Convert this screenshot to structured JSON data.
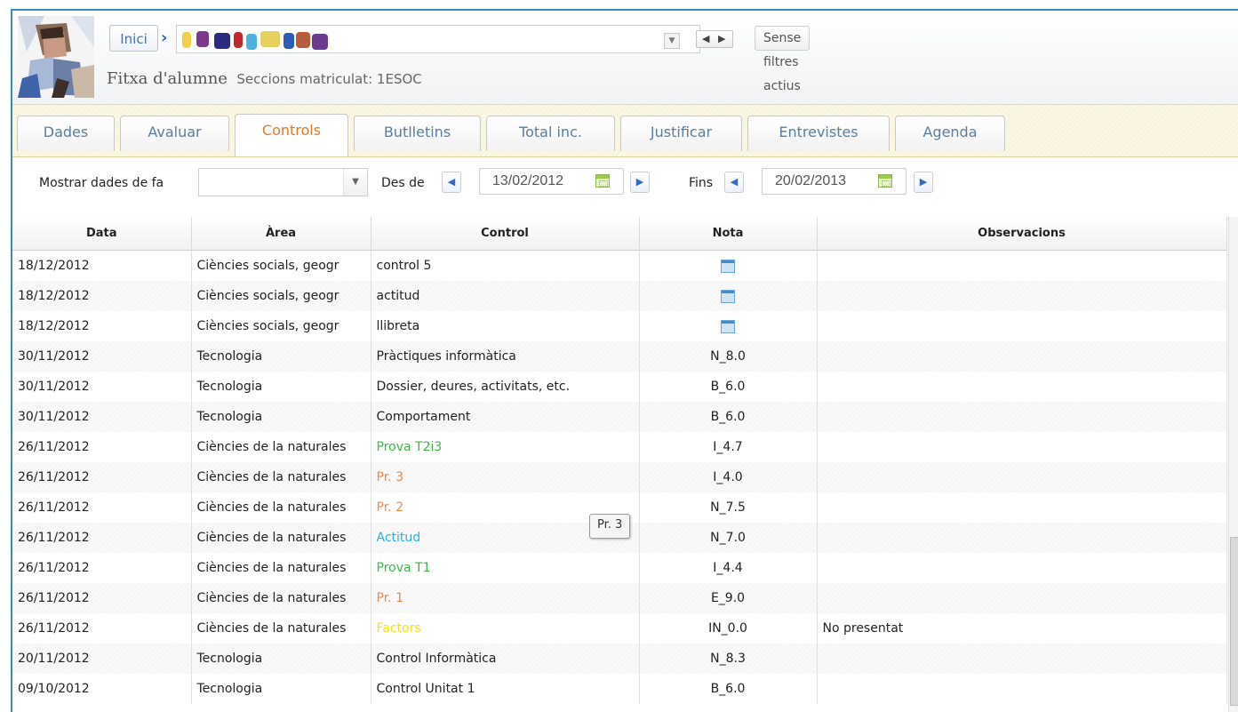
{
  "nav": {
    "home_label": "Inici",
    "crumb_sep": "›",
    "prev_glyph": "◀",
    "next_glyph": "▶",
    "filters_label": "Sense filtres actius"
  },
  "student": {
    "title": "Fitxa d'alumne",
    "sections": "Seccions matriculat: 1ESOC"
  },
  "tabs": [
    {
      "label": "Dades"
    },
    {
      "label": "Avaluar"
    },
    {
      "label": "Controls",
      "active": true
    },
    {
      "label": "Butlletins"
    },
    {
      "label": "Total inc."
    },
    {
      "label": "Justificar"
    },
    {
      "label": "Entrevistes"
    },
    {
      "label": "Agenda"
    }
  ],
  "filters": {
    "show_label": "Mostrar dades de fa",
    "show_value": "",
    "from_label": "Des de",
    "from_date": "13/02/2012",
    "to_label": "Fins",
    "to_date": "20/02/2013"
  },
  "table": {
    "columns": [
      "Data",
      "Àrea",
      "Control",
      "Nota",
      "Observacions"
    ],
    "rows": [
      {
        "date": "18/12/2012",
        "area": "Ciències socials, geogr",
        "control": "control 5",
        "nota": "",
        "obs": "",
        "color": "#222222"
      },
      {
        "date": "18/12/2012",
        "area": "Ciències socials, geogr",
        "control": "actitud",
        "nota": "",
        "obs": "",
        "color": "#222222"
      },
      {
        "date": "18/12/2012",
        "area": "Ciències socials, geogr",
        "control": "llibreta",
        "nota": "",
        "obs": "",
        "color": "#222222"
      },
      {
        "date": "30/11/2012",
        "area": "Tecnologia",
        "control": "Pràctiques informàtica",
        "nota": "N_8.0",
        "obs": "",
        "color": "#222222"
      },
      {
        "date": "30/11/2012",
        "area": "Tecnologia",
        "control": "Dossier, deures, activitats, etc.",
        "nota": "B_6.0",
        "obs": "",
        "color": "#222222"
      },
      {
        "date": "30/11/2012",
        "area": "Tecnologia",
        "control": "Comportament",
        "nota": "B_6.0",
        "obs": "",
        "color": "#222222"
      },
      {
        "date": "26/11/2012",
        "area": "Ciències de la naturales",
        "control": "Prova T2i3",
        "nota": "I_4.7",
        "obs": "",
        "color": "#3bb84a"
      },
      {
        "date": "26/11/2012",
        "area": "Ciències de la naturales",
        "control": "Pr. 3",
        "nota": "I_4.0",
        "obs": "",
        "color": "#f08a4b"
      },
      {
        "date": "26/11/2012",
        "area": "Ciències de la naturales",
        "control": "Pr. 2",
        "nota": "N_7.5",
        "obs": "",
        "color": "#f08a4b"
      },
      {
        "date": "26/11/2012",
        "area": "Ciències de la naturales",
        "control": "Actitud",
        "nota": "N_7.0",
        "obs": "",
        "color": "#2ab4e0"
      },
      {
        "date": "26/11/2012",
        "area": "Ciències de la naturales",
        "control": "Prova T1",
        "nota": "I_4.4",
        "obs": "",
        "color": "#3bb84a"
      },
      {
        "date": "26/11/2012",
        "area": "Ciències de la naturales",
        "control": "Pr. 1",
        "nota": "E_9.0",
        "obs": "",
        "color": "#f08a4b"
      },
      {
        "date": "26/11/2012",
        "area": "Ciències de la naturales",
        "control": "Factors",
        "nota": "IN_0.0",
        "obs": "No presentat",
        "color": "#f2e41c"
      },
      {
        "date": "20/11/2012",
        "area": "Tecnologia",
        "control": "Control Informàtica",
        "nota": "N_8.3",
        "obs": "",
        "color": "#222222"
      },
      {
        "date": "09/10/2012",
        "area": "Tecnologia",
        "control": "Control Unitat 1",
        "nota": "B_6.0",
        "obs": "",
        "color": "#222222"
      }
    ]
  },
  "tooltip": "Pr. 3",
  "icons": {
    "calendar": "calendar-icon"
  }
}
